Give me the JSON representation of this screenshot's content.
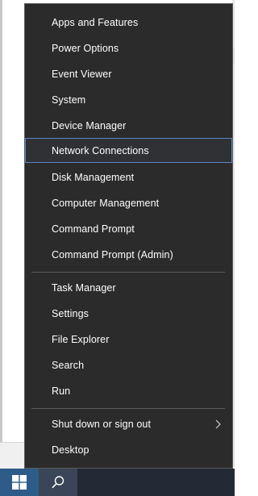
{
  "menu": {
    "group1": [
      {
        "id": "apps-and-features",
        "label": "Apps and Features"
      },
      {
        "id": "power-options",
        "label": "Power Options"
      },
      {
        "id": "event-viewer",
        "label": "Event Viewer"
      },
      {
        "id": "system",
        "label": "System"
      },
      {
        "id": "device-manager",
        "label": "Device Manager"
      },
      {
        "id": "network-connections",
        "label": "Network Connections"
      },
      {
        "id": "disk-management",
        "label": "Disk Management"
      },
      {
        "id": "computer-management",
        "label": "Computer Management"
      },
      {
        "id": "command-prompt",
        "label": "Command Prompt"
      },
      {
        "id": "command-prompt-admin",
        "label": "Command Prompt (Admin)"
      }
    ],
    "group2": [
      {
        "id": "task-manager",
        "label": "Task Manager"
      },
      {
        "id": "settings",
        "label": "Settings"
      },
      {
        "id": "file-explorer",
        "label": "File Explorer"
      },
      {
        "id": "search",
        "label": "Search"
      },
      {
        "id": "run",
        "label": "Run"
      }
    ],
    "group3": [
      {
        "id": "shut-down-or-sign-out",
        "label": "Shut down or sign out",
        "submenu_icon": "chevron-right-icon"
      },
      {
        "id": "desktop",
        "label": "Desktop"
      }
    ],
    "highlighted_item": "Network Connections"
  },
  "taskbar": {
    "start_icon": "windows-logo-icon",
    "search_icon": "search-icon"
  },
  "colors": {
    "menu_background": "#2b2b2b",
    "menu_text": "#ffffff",
    "highlight_border": "#5b86c4",
    "separator": "#5c5c5c",
    "taskbar": "#232a36",
    "start_button": "#2d5c88"
  }
}
